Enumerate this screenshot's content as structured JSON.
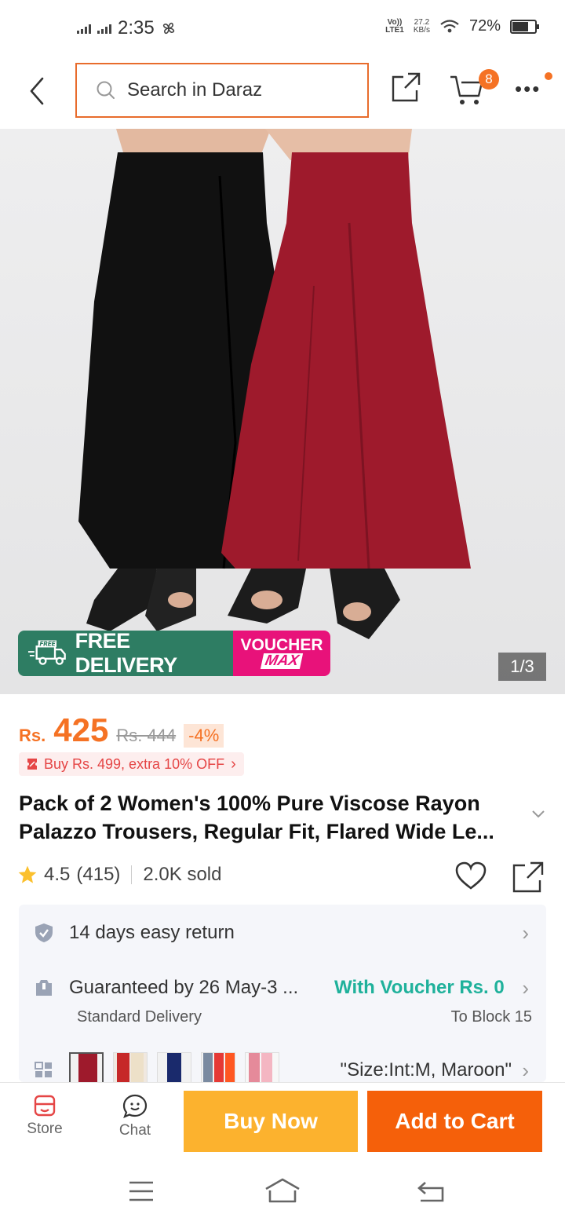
{
  "status_bar": {
    "time": "2:35",
    "volte": "Vo)) LTE1",
    "speed_value": "27.2",
    "speed_unit": "KB/s",
    "battery": "72%",
    "battery_level": 0.72
  },
  "header": {
    "search_placeholder": "Search in Daraz",
    "cart_count": "8"
  },
  "hero": {
    "free_delivery": "FREE DELIVERY",
    "free_tag": "FREE",
    "voucher_line1": "VOUCHER",
    "voucher_line2": "MAX",
    "pager": "1/3"
  },
  "price": {
    "currency": "Rs.",
    "current": "425",
    "original": "Rs. 444",
    "discount": "-4%",
    "deal": "Buy Rs. 499, extra 10% OFF"
  },
  "product": {
    "title": "Pack of 2 Women's 100% Pure Viscose Rayon Palazzo Trousers, Regular Fit, Flared Wide Le...",
    "rating": "4.5",
    "reviews": "(415)",
    "sold": "2.0K sold"
  },
  "services": {
    "returns": "14 days easy return",
    "delivery": "Guaranteed by 26 May-3 ...",
    "voucher": "With Voucher Rs. 0",
    "delivery_type": "Standard Delivery",
    "destination": "To Block 15",
    "variant": "\"Size:Int:M, Maroon\""
  },
  "bottom_bar": {
    "store": "Store",
    "chat": "Chat",
    "buy_now": "Buy Now",
    "add_to_cart": "Add to Cart"
  },
  "colors": {
    "accent": "#f57224",
    "buy_now": "#fcb22e",
    "add_to_cart": "#f5600a",
    "voucher_text": "#1fb19b",
    "free_delivery_bg": "#2e7d63",
    "voucher_max_bg": "#e8127a"
  }
}
